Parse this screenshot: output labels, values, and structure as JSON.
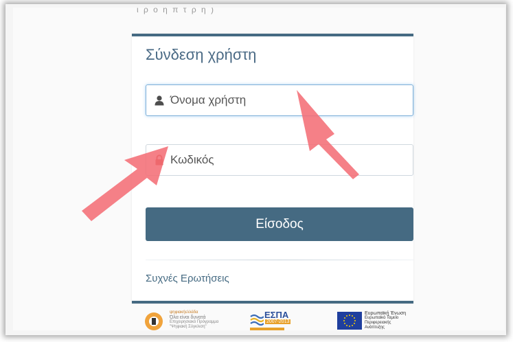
{
  "top_fragment": "ι  ρ  ο  η  π  τ  ρ  ή  )",
  "login": {
    "title": "Σύνδεση χρήστη",
    "username_placeholder": "Όνομα χρήστη",
    "password_placeholder": "Κωδικός",
    "submit_label": "Είσοδος",
    "faq_link": "Συχνές Ερωτήσεις"
  },
  "footer": {
    "logo1_line1": "ψηφιακήελλάδα",
    "logo1_line2": "Όλα είναι δυνατά",
    "logo1_line3": "Επιχειρησιακό Πρόγραμμα",
    "logo1_line4": "\"Ψηφιακή Σύγκλιση\"",
    "logo2_title": "ΕΣΠΑ",
    "logo2_years": "2007-2013",
    "logo3_line1": "Ευρωπαϊκή Ένωση",
    "logo3_line2": "Ευρωπαϊκό Ταμείο",
    "logo3_line3": "Περιφερειακής",
    "logo3_line4": "Ανάπτυξης"
  },
  "colors": {
    "primary": "#456a82",
    "arrow": "#f46e76",
    "lock": "#c0392b"
  }
}
